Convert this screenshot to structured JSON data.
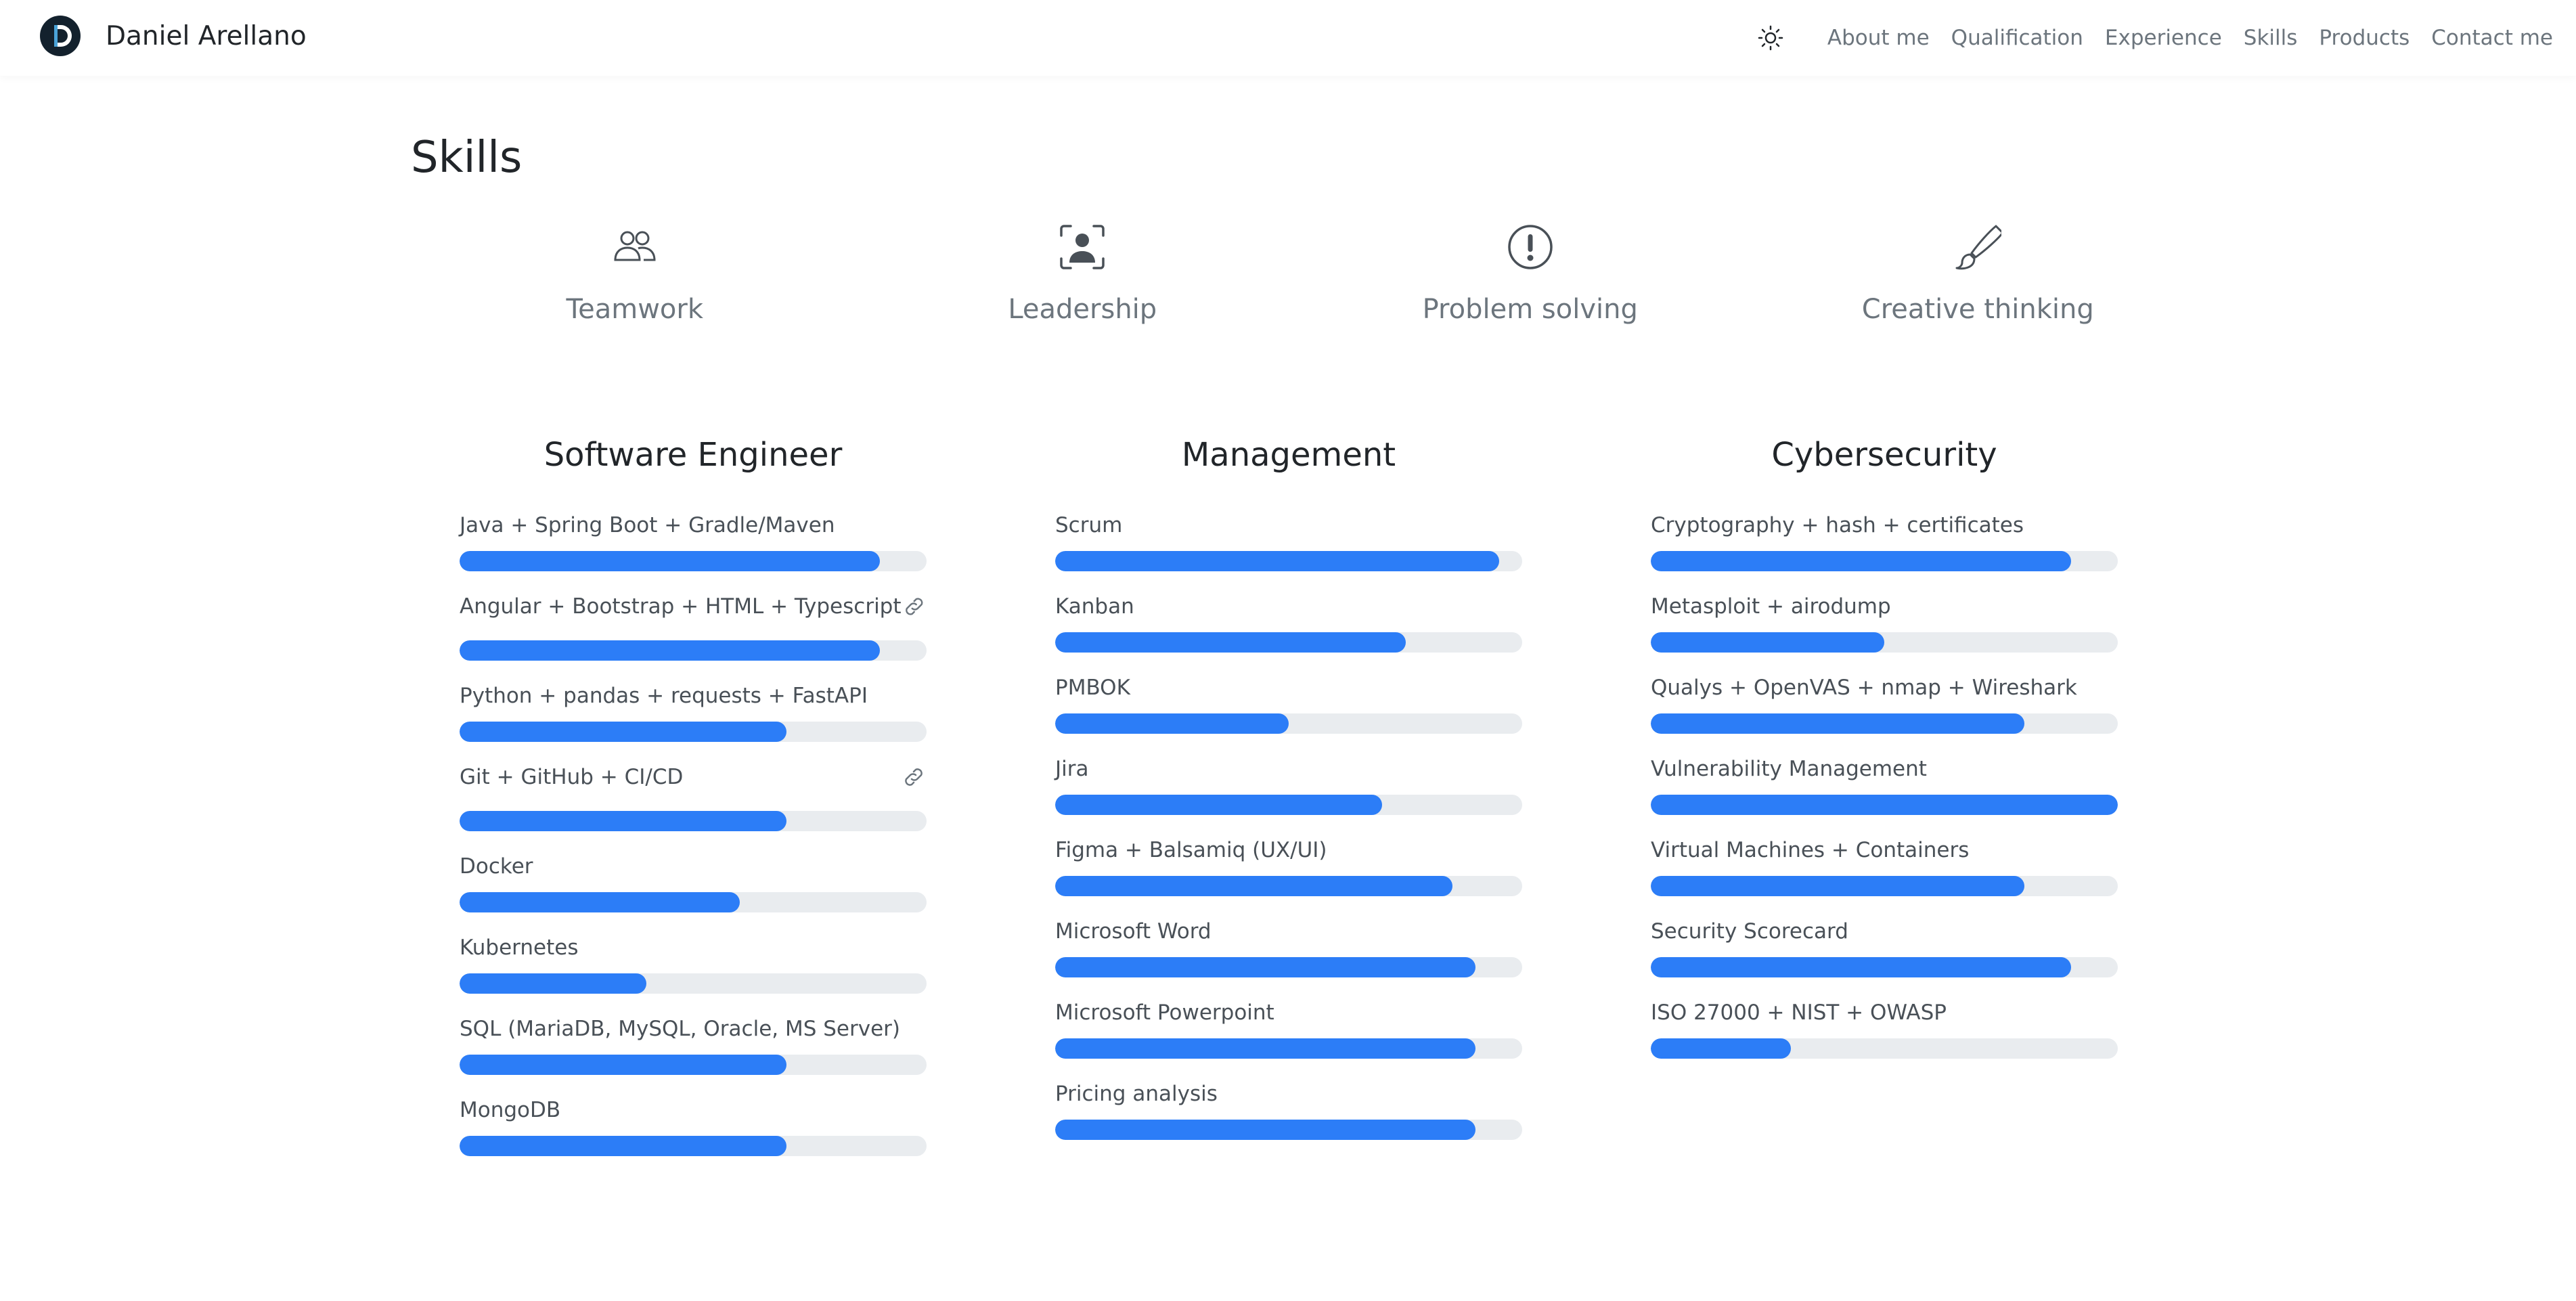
{
  "navbar": {
    "brand": "Daniel Arellano",
    "links": [
      "About me",
      "Qualification",
      "Experience",
      "Skills",
      "Products",
      "Contact me"
    ]
  },
  "section_title": "Skills",
  "soft_skills": [
    {
      "label": "Teamwork",
      "icon": "people-icon"
    },
    {
      "label": "Leadership",
      "icon": "person-focus-icon"
    },
    {
      "label": "Problem solving",
      "icon": "exclamation-circle-icon"
    },
    {
      "label": "Creative thinking",
      "icon": "brush-icon"
    }
  ],
  "columns": [
    {
      "title": "Software Engineer",
      "skills": [
        {
          "label": "Java + Spring Boot + Gradle/Maven",
          "level": 90,
          "link": false
        },
        {
          "label": "Angular + Bootstrap + HTML + Typescript",
          "level": 90,
          "link": true
        },
        {
          "label": "Python + pandas + requests + FastAPI",
          "level": 70,
          "link": false
        },
        {
          "label": "Git + GitHub + CI/CD",
          "level": 70,
          "link": true
        },
        {
          "label": "Docker",
          "level": 60,
          "link": false
        },
        {
          "label": "Kubernetes",
          "level": 40,
          "link": false
        },
        {
          "label": "SQL (MariaDB, MySQL, Oracle, MS Server)",
          "level": 70,
          "link": false
        },
        {
          "label": "MongoDB",
          "level": 70,
          "link": false
        }
      ]
    },
    {
      "title": "Management",
      "skills": [
        {
          "label": "Scrum",
          "level": 95,
          "link": false
        },
        {
          "label": "Kanban",
          "level": 75,
          "link": false
        },
        {
          "label": "PMBOK",
          "level": 50,
          "link": false
        },
        {
          "label": "Jira",
          "level": 70,
          "link": false
        },
        {
          "label": "Figma + Balsamiq (UX/UI)",
          "level": 85,
          "link": false
        },
        {
          "label": "Microsoft Word",
          "level": 90,
          "link": false
        },
        {
          "label": "Microsoft Powerpoint",
          "level": 90,
          "link": false
        },
        {
          "label": "Pricing analysis",
          "level": 90,
          "link": false
        }
      ]
    },
    {
      "title": "Cybersecurity",
      "skills": [
        {
          "label": "Cryptography + hash + certificates",
          "level": 90,
          "link": false
        },
        {
          "label": "Metasploit + airodump",
          "level": 50,
          "link": false
        },
        {
          "label": "Qualys + OpenVAS + nmap + Wireshark",
          "level": 80,
          "link": false
        },
        {
          "label": "Vulnerability Management",
          "level": 100,
          "link": false
        },
        {
          "label": "Virtual Machines + Containers",
          "level": 80,
          "link": false
        },
        {
          "label": "Security Scorecard",
          "level": 90,
          "link": false
        },
        {
          "label": "ISO 27000 + NIST + OWASP",
          "level": 30,
          "link": false
        }
      ]
    }
  ],
  "colors": {
    "accent": "#2c7df7",
    "track": "#e9ecef",
    "muted_text": "#6c757d"
  }
}
